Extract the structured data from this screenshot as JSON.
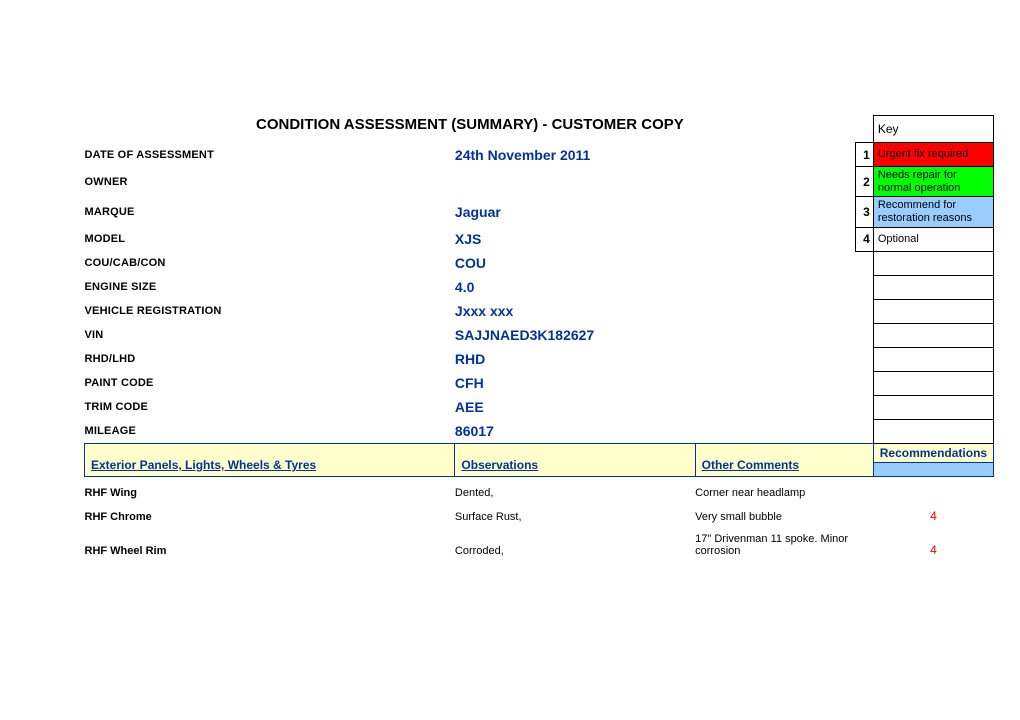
{
  "header": {
    "title": "CONDITION ASSESSMENT (SUMMARY) - CUSTOMER COPY"
  },
  "key": {
    "title": "Key",
    "items": [
      {
        "num": "1",
        "label": "Urgent fix required",
        "cls": "key-red"
      },
      {
        "num": "2",
        "label": "Needs repair for normal operation",
        "cls": "key-green"
      },
      {
        "num": "3",
        "label": "Recommend for restoration reasons",
        "cls": "key-blue"
      },
      {
        "num": "4",
        "label": "Optional",
        "cls": "key-white"
      }
    ]
  },
  "fields": [
    {
      "label": "DATE OF ASSESSMENT",
      "value": "24th November 2011"
    },
    {
      "label": "OWNER",
      "value": ""
    },
    {
      "label": "MARQUE",
      "value": "Jaguar"
    },
    {
      "label": "MODEL",
      "value": "XJS"
    },
    {
      "label": "COU/CAB/CON",
      "value": "COU"
    },
    {
      "label": "ENGINE SIZE",
      "value": "4.0"
    },
    {
      "label": "VEHICLE REGISTRATION",
      "value": "Jxxx xxx"
    },
    {
      "label": "VIN",
      "value": "SAJJNAED3K182627"
    },
    {
      "label": "RHD/LHD",
      "value": "RHD"
    },
    {
      "label": "PAINT CODE",
      "value": "CFH"
    },
    {
      "label": "TRIM CODE",
      "value": "AEE"
    },
    {
      "label": "MILEAGE",
      "value": "86017"
    }
  ],
  "section": {
    "col1": "Exterior Panels, Lights, Wheels & Tyres",
    "col2": "Observations",
    "col3": "Other Comments",
    "col4": "Recommendations"
  },
  "rows": [
    {
      "item": "RHF Wing",
      "obs": "Dented,",
      "comm": "Corner near headlamp",
      "rec": ""
    },
    {
      "item": "RHF Chrome",
      "obs": "Surface Rust,",
      "comm": "Very small bubble",
      "rec": "4"
    },
    {
      "item": "RHF Wheel Rim",
      "obs": "Corroded,",
      "comm": "17\" Drivenman 11 spoke. Minor corrosion",
      "rec": "4"
    }
  ]
}
